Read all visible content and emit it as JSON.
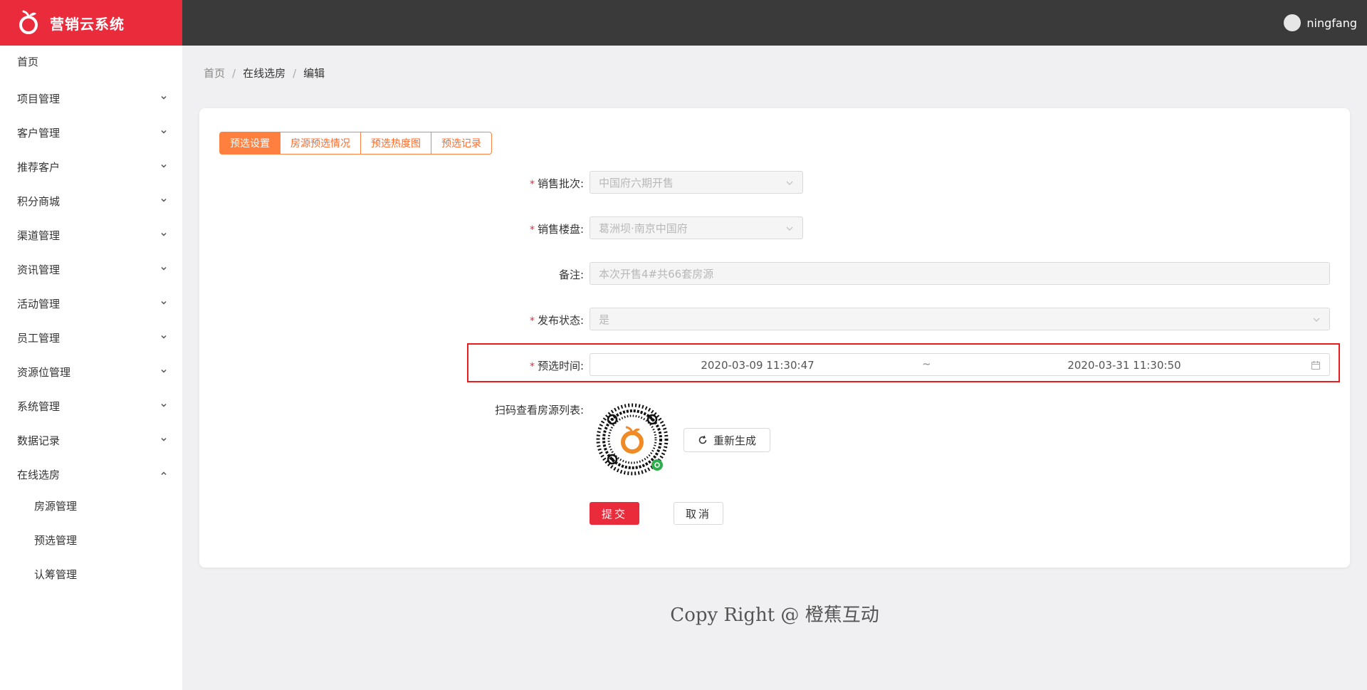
{
  "app": {
    "title": "营销云系统",
    "brand_color": "#ea2b3b",
    "accent_color": "#ff7f3e"
  },
  "user": {
    "name": "ningfang"
  },
  "sidebar": {
    "items": [
      {
        "label": "首页",
        "expandable": false
      },
      {
        "label": "项目管理",
        "expandable": true
      },
      {
        "label": "客户管理",
        "expandable": true
      },
      {
        "label": "推荐客户",
        "expandable": true
      },
      {
        "label": "积分商城",
        "expandable": true
      },
      {
        "label": "渠道管理",
        "expandable": true
      },
      {
        "label": "资讯管理",
        "expandable": true
      },
      {
        "label": "活动管理",
        "expandable": true
      },
      {
        "label": "员工管理",
        "expandable": true
      },
      {
        "label": "资源位管理",
        "expandable": true
      },
      {
        "label": "系统管理",
        "expandable": true
      },
      {
        "label": "数据记录",
        "expandable": true
      },
      {
        "label": "在线选房",
        "expandable": true,
        "expanded": true
      }
    ],
    "subitems": [
      {
        "label": "房源管理"
      },
      {
        "label": "预选管理"
      },
      {
        "label": "认筹管理"
      }
    ]
  },
  "breadcrumb": [
    "首页",
    "在线选房",
    "编辑"
  ],
  "tabs": [
    {
      "label": "预选设置",
      "active": true
    },
    {
      "label": "房源预选情况",
      "active": false
    },
    {
      "label": "预选热度图",
      "active": false
    },
    {
      "label": "预选记录",
      "active": false
    }
  ],
  "form": {
    "batch": {
      "label": "销售批次:",
      "value": "中国府六期开售",
      "required": true
    },
    "property": {
      "label": "销售楼盘:",
      "value": "葛洲坝·南京中国府",
      "required": true
    },
    "remark": {
      "label": "备注:",
      "value": "本次开售4#共66套房源",
      "required": false
    },
    "status": {
      "label": "发布状态:",
      "value": "是",
      "required": true
    },
    "time": {
      "label": "预选时间:",
      "start": "2020-03-09 11:30:47",
      "separator": "~",
      "end": "2020-03-31 11:30:50",
      "required": true
    },
    "qr": {
      "label": "扫码查看房源列表:",
      "regen_label": "重新生成"
    },
    "required_mark": "*"
  },
  "actions": {
    "submit": "提交",
    "cancel": "取消"
  },
  "footer": {
    "text": "Copy Right @ 橙蕉互动"
  }
}
